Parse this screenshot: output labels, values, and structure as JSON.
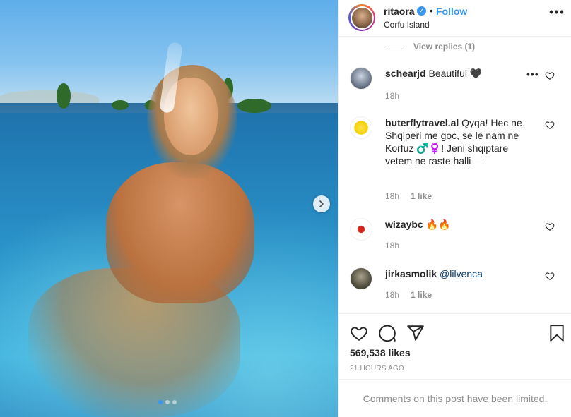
{
  "post": {
    "username": "ritaora",
    "verified_badge": "✓",
    "separator": "•",
    "follow_label": "Follow",
    "location": "Corfu Island",
    "more_label": "•••"
  },
  "comments": {
    "view_replies": "View replies (1)",
    "items": [
      {
        "user": "schearjd",
        "text": "Beautiful 🖤",
        "time": "18h",
        "likes": ""
      },
      {
        "user": "buterflytravel.al",
        "text": "Qyqa! Hec ne Shqiperi me goc, se le nam ne Korfuz ♂️♀️! Jeni shqiptare vetem ne raste halli —",
        "time": "18h",
        "likes": "1 like"
      },
      {
        "user": "wizaybc",
        "text": "🔥🔥",
        "time": "18h",
        "likes": ""
      },
      {
        "user": "jirkasmolik",
        "text": "@lilvenca",
        "time": "18h",
        "likes": "1 like"
      }
    ],
    "comment_more_label": "•••"
  },
  "actions": {
    "likes": "569,538 likes",
    "time_ago": "21 HOURS AGO"
  },
  "footer": {
    "limited_text": "Comments on this post have been limited."
  },
  "carousel": {
    "active_index": 1,
    "count": 3
  },
  "colors": {
    "accent": "#3897f0",
    "text": "#262626",
    "muted": "#8e8e8e",
    "border": "#efefef"
  },
  "icons": [
    "chevron-right-icon",
    "verified-icon",
    "more-icon",
    "heart-icon",
    "comment-icon",
    "share-icon",
    "bookmark-icon"
  ]
}
